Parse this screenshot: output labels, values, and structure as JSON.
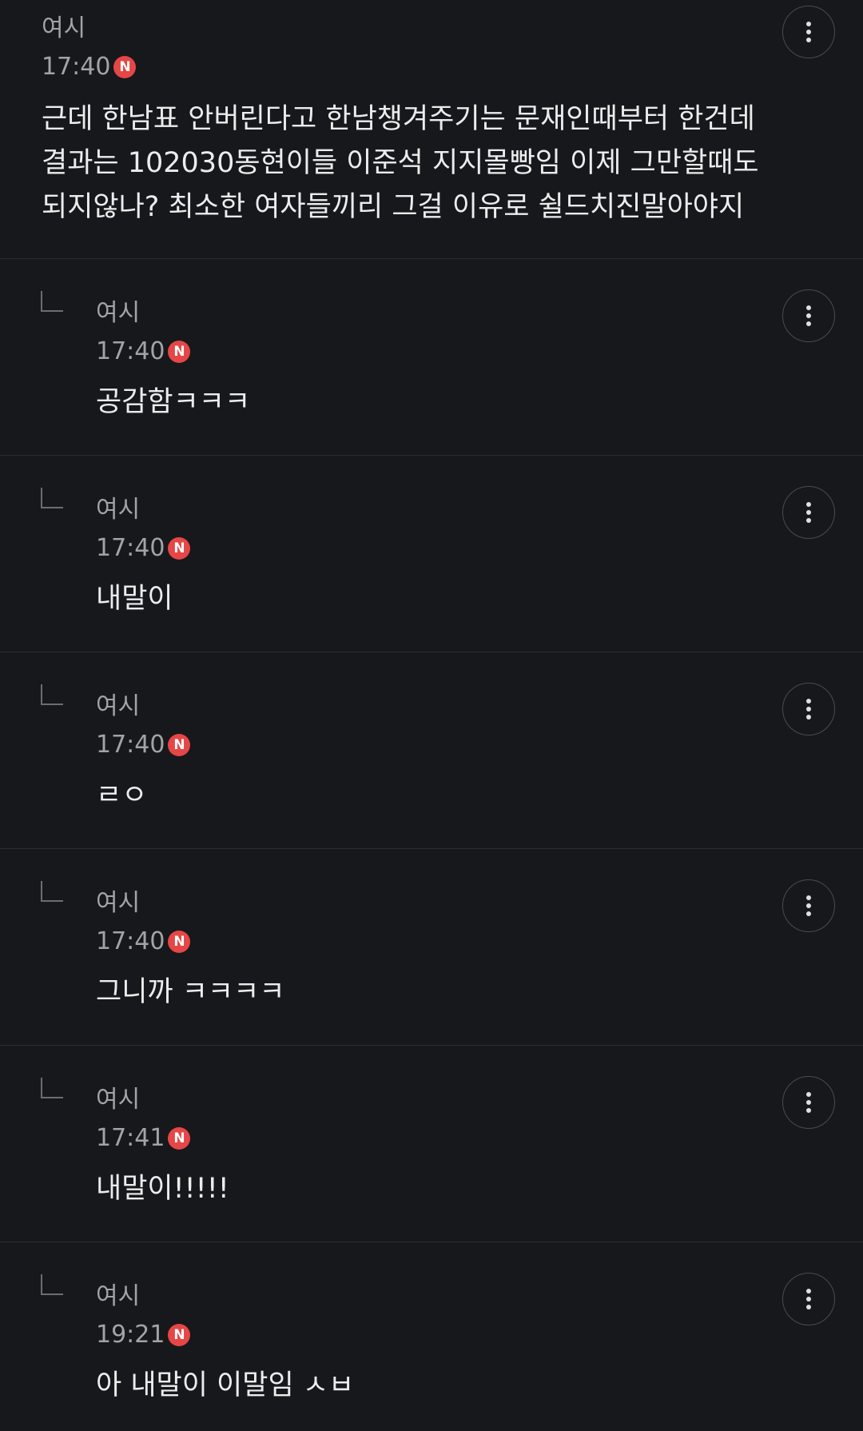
{
  "comments": {
    "main": {
      "author": "여시",
      "time": "17:40",
      "badge": "N",
      "text": "근데 한남표 안버린다고 한남챙겨주기는 문재인때부터 한건데\n결과는 102030동현이들 이준석 지지몰빵임 이제 그만할때도\n되지않나? 최소한 여자들끼리 그걸 이유로 쉴드치진말아야지",
      "more_icon": "more-vertical-icon"
    },
    "replies": [
      {
        "author": "여시",
        "time": "17:40",
        "badge": "N",
        "text": "공감함ㅋㅋㅋ"
      },
      {
        "author": "여시",
        "time": "17:40",
        "badge": "N",
        "text": "내말이"
      },
      {
        "author": "여시",
        "time": "17:40",
        "badge": "N",
        "text": "ㄹㅇ"
      },
      {
        "author": "여시",
        "time": "17:40",
        "badge": "N",
        "text": "그니까 ㅋㅋㅋㅋ"
      },
      {
        "author": "여시",
        "time": "17:41",
        "badge": "N",
        "text": "내말이!!!!!"
      },
      {
        "author": "여시",
        "time": "19:21",
        "badge": "N",
        "text": "아 내말이 이말임 ㅅㅂ"
      }
    ]
  },
  "colors": {
    "background": "#17181b",
    "divider": "#2c2d31",
    "badge": "#e64646",
    "meta_text": "#a3a3a6",
    "body_text": "#ececec"
  }
}
